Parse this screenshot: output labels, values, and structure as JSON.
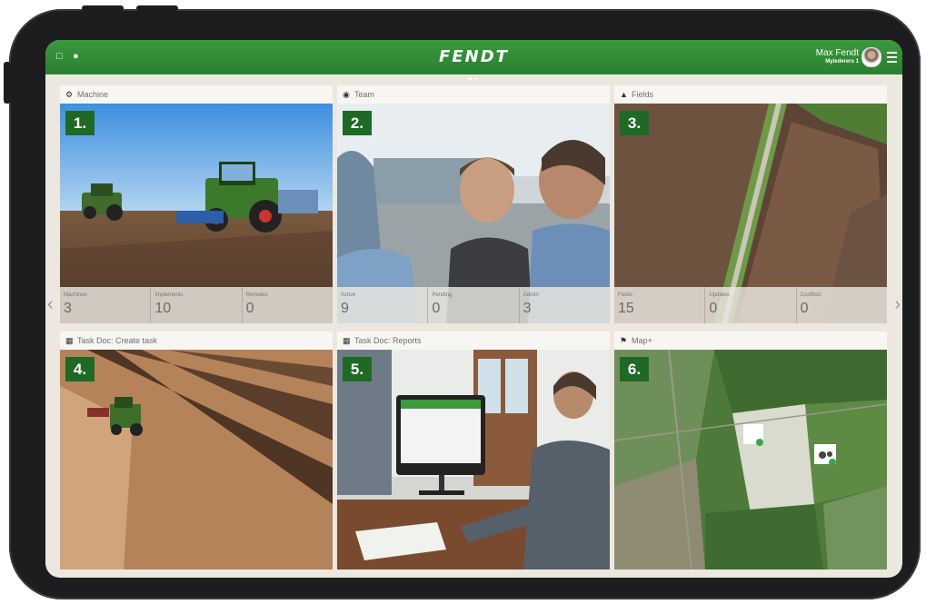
{
  "topbar": {
    "logo": "FENDT",
    "user_name": "Max Fendt",
    "farm_name": "Mylederers 1"
  },
  "tiles": [
    {
      "number": "1.",
      "title": "Machine",
      "icon": "tractor-icon",
      "stats": [
        {
          "label": "Machines",
          "value": "3"
        },
        {
          "label": "Implements",
          "value": "10"
        },
        {
          "label": "Remotes",
          "value": "0"
        }
      ]
    },
    {
      "number": "2.",
      "title": "Team",
      "icon": "person-icon",
      "stats": [
        {
          "label": "Active",
          "value": "9"
        },
        {
          "label": "Pending",
          "value": "0"
        },
        {
          "label": "Admin",
          "value": "3"
        }
      ]
    },
    {
      "number": "3.",
      "title": "Fields",
      "icon": "field-icon",
      "stats": [
        {
          "label": "Fields",
          "value": "15"
        },
        {
          "label": "Updates",
          "value": "0"
        },
        {
          "label": "Conflicts",
          "value": "0"
        }
      ]
    },
    {
      "number": "4.",
      "title": "Task Doc: Create task",
      "icon": "document-icon"
    },
    {
      "number": "5.",
      "title": "Task Doc: Reports",
      "icon": "document-icon"
    },
    {
      "number": "6.",
      "title": "Map+",
      "icon": "map-icon"
    }
  ],
  "colors": {
    "brand_green": "#2f8a34",
    "badge_green": "#1e6a25"
  }
}
